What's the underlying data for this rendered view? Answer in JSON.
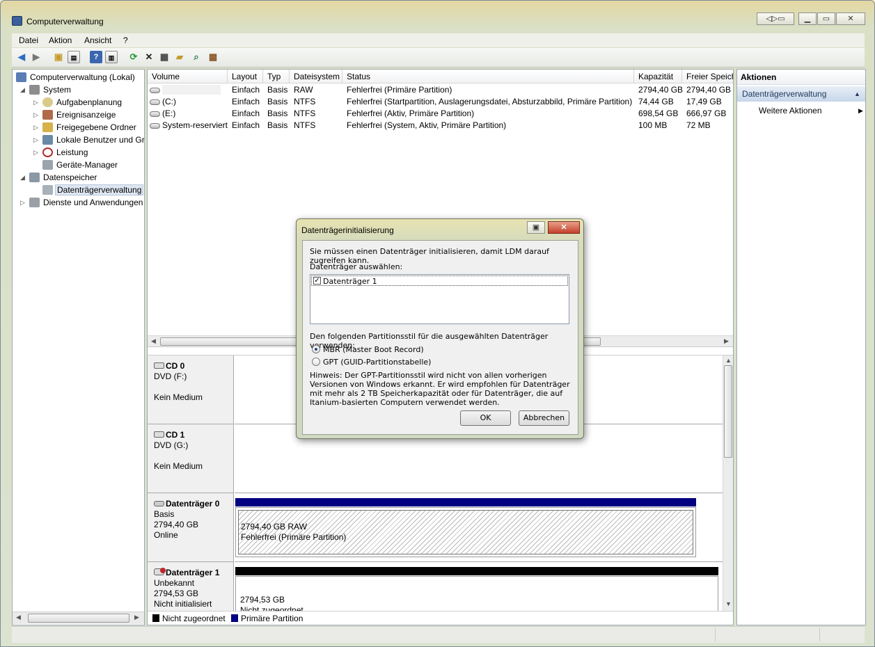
{
  "window": {
    "title": "Computerverwaltung"
  },
  "menu": [
    "Datei",
    "Aktion",
    "Ansicht",
    "?"
  ],
  "tree": {
    "root": "Computerverwaltung (Lokal)",
    "system": "System",
    "aufgaben": "Aufgabenplanung",
    "ereignis": "Ereignisanzeige",
    "freigegeben": "Freigegebene Ordner",
    "lokal": "Lokale Benutzer und Gruppen",
    "leistung": "Leistung",
    "geraete": "Geräte-Manager",
    "datenspeicher": "Datenspeicher",
    "datentraeger": "Datenträgerverwaltung",
    "dienste": "Dienste und Anwendungen"
  },
  "volume_table": {
    "columns": [
      "Volume",
      "Layout",
      "Typ",
      "Dateisystem",
      "Status",
      "Kapazität",
      "Freier Speich"
    ],
    "rows": [
      [
        "",
        "Einfach",
        "Basis",
        "RAW",
        "Fehlerfrei (Primäre Partition)",
        "2794,40 GB",
        "2794,40 GB"
      ],
      [
        "(C:)",
        "Einfach",
        "Basis",
        "NTFS",
        "Fehlerfrei (Startpartition, Auslagerungsdatei, Absturzabbild, Primäre Partition)",
        "74,44 GB",
        "17,49 GB"
      ],
      [
        "(E:)",
        "Einfach",
        "Basis",
        "NTFS",
        "Fehlerfrei (Aktiv, Primäre Partition)",
        "698,54 GB",
        "666,97 GB"
      ],
      [
        "System-reserviert",
        "Einfach",
        "Basis",
        "NTFS",
        "Fehlerfrei (System, Aktiv, Primäre Partition)",
        "100 MB",
        "72 MB"
      ]
    ]
  },
  "disks": {
    "cd0": {
      "name": "CD 0",
      "type": "DVD (F:)",
      "status": "Kein Medium"
    },
    "cd1": {
      "name": "CD 1",
      "type": "DVD (G:)",
      "status": "Kein Medium"
    },
    "disk0": {
      "name": "Datenträger 0",
      "kind": "Basis",
      "size": "2794,40 GB",
      "status": "Online",
      "part_line1": "2794,40 GB RAW",
      "part_line2": "Fehlerfrei (Primäre Partition)"
    },
    "disk1": {
      "name": "Datenträger 1",
      "kind": "Unbekannt",
      "size": "2794,53 GB",
      "status": "Nicht initialisiert",
      "part_line1": "2794,53 GB",
      "part_line2": "Nicht zugeordnet"
    }
  },
  "legend": {
    "unallocated": "Nicht zugeordnet",
    "primary": "Primäre Partition",
    "unallocated_color": "#000000",
    "primary_color": "#000080"
  },
  "actions": {
    "title": "Aktionen",
    "section": "Datenträgerverwaltung",
    "more": "Weitere Aktionen"
  },
  "dialog": {
    "title": "Datenträgerinitialisierung",
    "intro": "Sie müssen einen Datenträger initialisieren, damit LDM darauf zugreifen kann.",
    "select_label": "Datenträger auswählen:",
    "disk_item": "Datenträger 1",
    "disk_item_checked": true,
    "style_label": "Den folgenden Partitionsstil für die ausgewählten Datenträger verwenden:",
    "mbr": "MBR (Master Boot Record)",
    "gpt": "GPT (GUID-Partitionstabelle)",
    "selected_style": "MBR",
    "hint": "Hinweis: Der GPT-Partitionsstil wird nicht von allen vorherigen Versionen von Windows erkannt. Er wird empfohlen für Datenträger mit mehr als 2 TB Speicherkapazität oder für Datenträger, die auf Itanium-basierten Computern verwendet werden.",
    "ok": "OK",
    "cancel": "Abbrechen"
  }
}
